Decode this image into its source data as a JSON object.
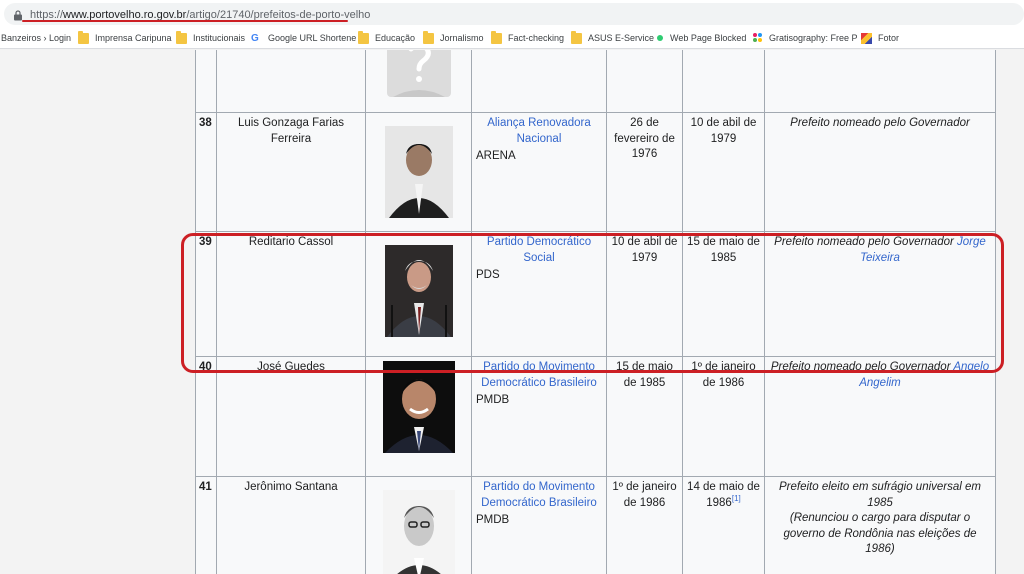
{
  "browser": {
    "url_prefix": "https://",
    "url_domain": "www.portovelho.ro.gov.br",
    "url_path": "/artigo/21740/prefeitos-de-porto-velho"
  },
  "bookmarks": [
    {
      "label": "Banzeiros › Login",
      "icon": "none"
    },
    {
      "label": "Imprensa Caripuna",
      "icon": "folder-icon"
    },
    {
      "label": "Institucionais",
      "icon": "folder-icon"
    },
    {
      "label": "Google URL Shortene",
      "icon": "google-icon"
    },
    {
      "label": "Educação",
      "icon": "folder-icon"
    },
    {
      "label": "Jornalismo",
      "icon": "folder-icon"
    },
    {
      "label": "Fact-checking",
      "icon": "folder-icon"
    },
    {
      "label": "ASUS E-Service",
      "icon": "folder-icon"
    },
    {
      "label": "Web Page Blocked",
      "icon": "dot-icon"
    },
    {
      "label": "Gratisography: Free P",
      "icon": "gratisography-icon"
    },
    {
      "label": "Fotor",
      "icon": "fotor-icon"
    }
  ],
  "rows": [
    {
      "num": "",
      "name": "",
      "photo": "placeholder",
      "party": "",
      "abbr": "",
      "start": "",
      "end": "",
      "note": "",
      "note_link": ""
    },
    {
      "num": "38",
      "name": "Luis Gonzaga Farias Ferreira",
      "photo": "portrait",
      "party": "Aliança Renovadora Nacional",
      "abbr": "ARENA",
      "start": "26 de fevereiro de 1976",
      "end": "10 de abil de 1979",
      "note": "Prefeito nomeado pelo Governador",
      "note_link": ""
    },
    {
      "num": "39",
      "name": "Reditario Cassol",
      "photo": "portrait",
      "party": "Partido Democrático Social",
      "abbr": "PDS",
      "start": "10 de abil de 1979",
      "end": "15 de maio de 1985",
      "note": "Prefeito nomeado pelo Governador",
      "note_link": "Jorge Teixeira"
    },
    {
      "num": "40",
      "name": "José Guedes",
      "photo": "portrait",
      "party": "Partido do Movimento Democrático Brasileiro",
      "abbr": "PMDB",
      "start": "15 de maio de 1985",
      "end": "1º de janeiro de 1986",
      "note": "Prefeito nomeado pelo Governador",
      "note_link": "Angelo Angelim"
    },
    {
      "num": "41",
      "name": "Jerônimo Santana",
      "photo": "portrait",
      "party": "Partido do Movimento Democrático Brasileiro",
      "abbr": "PMDB",
      "start": "1º de janeiro de 1986",
      "end": "14 de maio de 1986",
      "end_ref": "[1]",
      "note": "Prefeito eleito em sufrágio universal em 1985",
      "note_extra": "(Renunciou o cargo para disputar o governo de Rondônia nas eleições de 1986)",
      "note_link": ""
    }
  ],
  "colors": {
    "link": "#3366cc",
    "highlight": "#cc1f24",
    "table_border": "#a2a9b1"
  }
}
